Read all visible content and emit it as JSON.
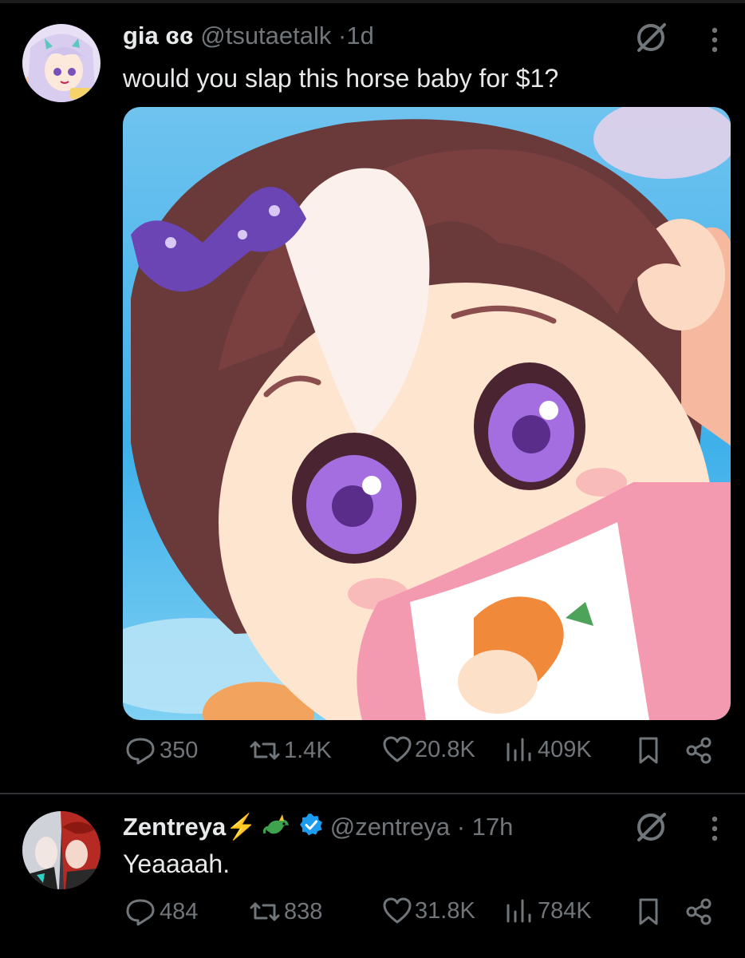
{
  "tweets": [
    {
      "display_name": "gia",
      "name_suffix": "ɞɞ",
      "handle": "@tsutaetalk",
      "separator": "·",
      "time": "1d",
      "text": "would you slap this horse baby for $1?",
      "stats": {
        "replies": "350",
        "reposts": "1.4K",
        "likes": "20.8K",
        "views": "409K"
      }
    },
    {
      "display_name": "Zentreya",
      "name_emoji": "⚡",
      "handle": "@zentreya",
      "separator": "·",
      "time": "17h",
      "text": "Yeaaaah.",
      "verified": true,
      "stats": {
        "replies": "484",
        "reposts": "838",
        "likes": "31.8K",
        "views": "784K"
      }
    }
  ],
  "icons": {
    "reply": "reply-icon",
    "repost": "repost-icon",
    "like": "heart-icon",
    "views": "views-icon",
    "bookmark": "bookmark-icon",
    "share": "share-icon",
    "grok": "grok-icon",
    "more": "more-icon",
    "verified": "verified-badge-icon"
  },
  "colors": {
    "background": "#000000",
    "text": "#e7e9ea",
    "secondary": "#71767b",
    "verified": "#1d9bf0"
  }
}
